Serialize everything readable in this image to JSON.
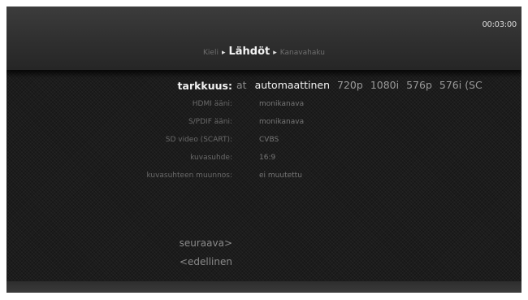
{
  "clock": "00:03:00",
  "breadcrumb": {
    "items": [
      "Kieli",
      "Lähdöt",
      "Kanavahaku"
    ],
    "separator": "▸"
  },
  "resolution": {
    "label": "tarkkuus:",
    "prefix": "at",
    "options": [
      "automaattinen",
      "720p",
      "1080i",
      "576p",
      "576i (SC"
    ]
  },
  "settings": [
    {
      "label": "HDMI ääni:",
      "value": "monikanava"
    },
    {
      "label": "S/PDIF ääni:",
      "value": "monikanava"
    },
    {
      "label": "SD video (SCART):",
      "value": "CVBS"
    },
    {
      "label": "kuvasuhde:",
      "value": "16:9"
    },
    {
      "label": "kuvasuhteen muunnos:",
      "value": "ei muutettu"
    }
  ],
  "nav": {
    "next": "seuraava>",
    "previous": "<edellinen"
  }
}
